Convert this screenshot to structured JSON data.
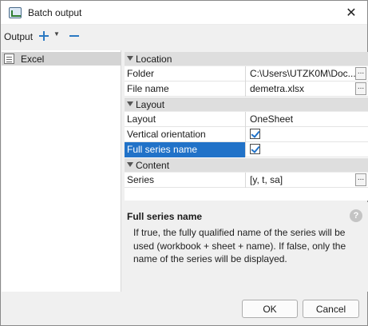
{
  "window": {
    "title": "Batch output"
  },
  "toolbar": {
    "label": "Output"
  },
  "outputs": [
    {
      "label": "Excel"
    }
  ],
  "properties": {
    "location": {
      "category": "Location",
      "folder": {
        "name": "Folder",
        "value": "C:\\Users\\UTZK0M\\Doc..."
      },
      "file_name": {
        "name": "File name",
        "value": "demetra.xlsx"
      }
    },
    "layout": {
      "category": "Layout",
      "layout": {
        "name": "Layout",
        "value": "OneSheet"
      },
      "vertical_orientation": {
        "name": "Vertical orientation",
        "checked": true
      },
      "full_series_name": {
        "name": "Full series name",
        "checked": true
      }
    },
    "content": {
      "category": "Content",
      "series": {
        "name": "Series",
        "value": "[y, t, sa]"
      }
    },
    "ellipsis_label": "..."
  },
  "description": {
    "title": "Full series name",
    "text": "If true, the fully qualified name of the series will be used (workbook + sheet + name). If false, only the name of the series will be displayed.",
    "help_glyph": "?"
  },
  "buttons": {
    "ok": "OK",
    "cancel": "Cancel"
  },
  "colors": {
    "selection": "#2172c8",
    "accent": "#2b79c2"
  }
}
